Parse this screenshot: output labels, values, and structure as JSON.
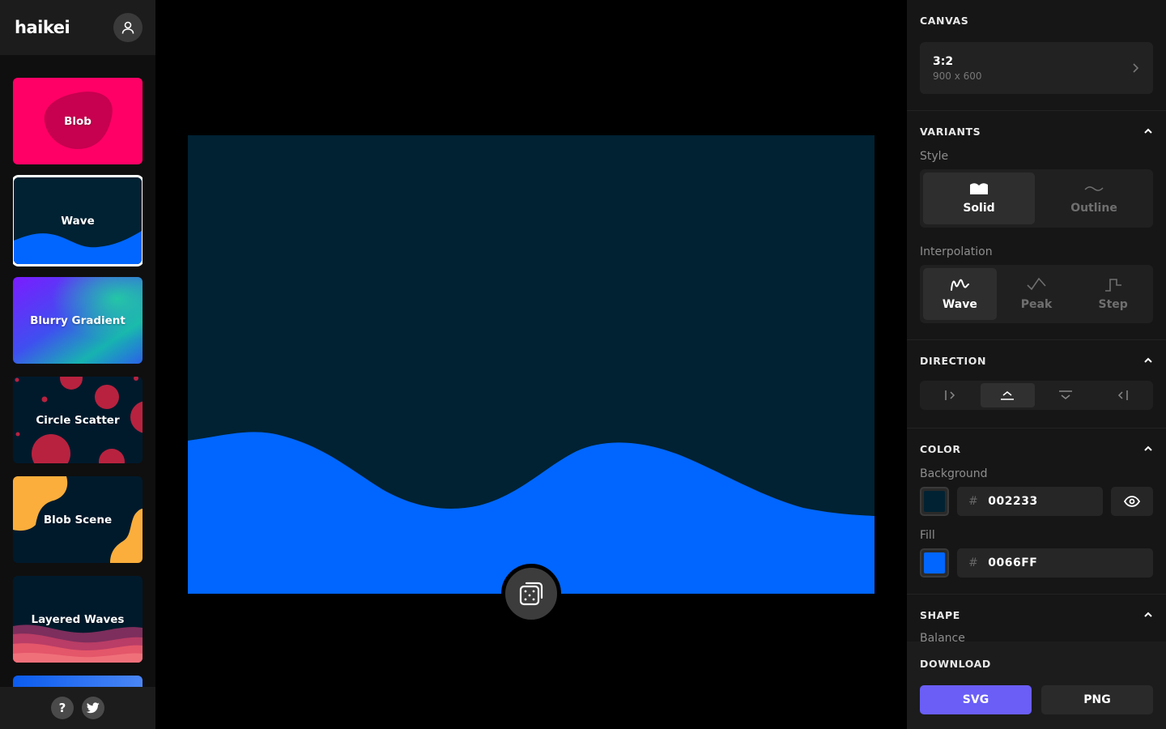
{
  "app": {
    "logo": "haikei"
  },
  "sidebar": {
    "generators": [
      {
        "label": "Blob"
      },
      {
        "label": "Wave"
      },
      {
        "label": "Blurry Gradient"
      },
      {
        "label": "Circle Scatter"
      },
      {
        "label": "Blob Scene"
      },
      {
        "label": "Layered Waves"
      }
    ],
    "active_generator": "Wave",
    "help_label": "?"
  },
  "panel": {
    "canvas": {
      "title": "CANVAS",
      "ratio": "3:2",
      "dimensions": "900 x 600"
    },
    "variants": {
      "title": "VARIANTS",
      "style_label": "Style",
      "style_options": [
        "Solid",
        "Outline"
      ],
      "style_selected": "Solid",
      "interpolation_label": "Interpolation",
      "interpolation_options": [
        "Wave",
        "Peak",
        "Step"
      ],
      "interpolation_selected": "Wave"
    },
    "direction": {
      "title": "DIRECTION",
      "options": [
        "left-to-right",
        "bottom-up",
        "top-down",
        "right-to-left"
      ],
      "selected": "bottom-up"
    },
    "color": {
      "title": "COLOR",
      "background_label": "Background",
      "background_hex": "002233",
      "fill_label": "Fill",
      "fill_hex": "0066FF",
      "hash": "#"
    },
    "shape": {
      "title": "SHAPE",
      "balance_label": "Balance"
    },
    "download": {
      "title": "DOWNLOAD",
      "svg_label": "SVG",
      "png_label": "PNG"
    }
  },
  "colors": {
    "background": "#002233",
    "fill": "#0066FF",
    "accent": "#6A5EF7",
    "blob_card": "#FF0066"
  }
}
